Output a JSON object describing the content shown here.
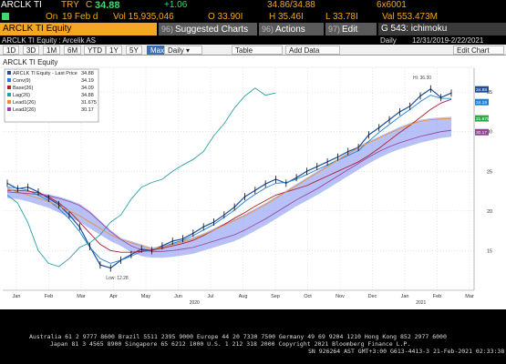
{
  "quote": {
    "ticker": "ARCLK TI",
    "currency": "TRY",
    "price_prefix": "C",
    "last_price": "34.88",
    "change": "+1.06",
    "bid_ask": "34.86/34.88",
    "size": "6x6001",
    "open_flag": "On",
    "date": "19 Feb d",
    "volume": "Vol 15,935,046",
    "open": "O 33.90I",
    "high": "H 35.46I",
    "low": "L 33.78I",
    "value": "Val 553.473M"
  },
  "toolbar": {
    "equity_label": "ARCLK TI Equity",
    "suggested_num": "96)",
    "suggested_label": "Suggested Charts",
    "actions_num": "96)",
    "actions_label": "Actions",
    "edit_num": "97)",
    "edit_label": "Edit",
    "page_label": "G 543: ichimoku"
  },
  "info_row": {
    "security": "ARCLK TI Equity : Arcelik AS",
    "frequency": "Daily",
    "date_range": "12/31/2019-2/22/2021"
  },
  "range_tabs": [
    "1D",
    "3D",
    "1M",
    "6M",
    "YTD",
    "1Y",
    "5Y"
  ],
  "range_selected": "Max",
  "frequency_select": "Daily",
  "table_label": "Table",
  "add_data_label": "Add Data",
  "edit_chart_label": "Edit Chart",
  "chart_title": "ARCLK TI Equity",
  "colors": {
    "accent": "#f5a623",
    "price": "#1f4e9a",
    "conversion": "#1f7fd1",
    "base": "#b01c2e",
    "lag": "#2a9fa6",
    "lead1": "#e8902a",
    "lead2": "#9a3f9a",
    "cloud": "#7b8ef0"
  },
  "chart_data": {
    "type": "line",
    "x_ticks": [
      "Jan",
      "Feb",
      "Mar",
      "Apr",
      "May",
      "Jun",
      "Jul",
      "Aug",
      "Sep",
      "Oct",
      "Nov",
      "Dec",
      "Jan",
      "Feb",
      "Mar"
    ],
    "year_labels": [
      "2020",
      "2021"
    ],
    "ylim": [
      10,
      38
    ],
    "y_ticks": [
      "35",
      "30",
      "25",
      "20",
      "15"
    ],
    "high_annotation": "Hi: 36.30",
    "low_annotation": "Low: 12.28",
    "legend_title": "ARCLK TI Equity - Last Price",
    "legend": [
      {
        "name": "Conv(9)",
        "value": "34.19"
      },
      {
        "name": "Base(26)",
        "value": "34.09"
      },
      {
        "name": "Lag(26)",
        "value": "34.88"
      },
      {
        "name": "Lead1(26)",
        "value": "31.675"
      },
      {
        "name": "Lead2(26)",
        "value": "30.17"
      }
    ],
    "last_price_value": "34.88",
    "right_tags": [
      "34.88",
      "34.19",
      "30.17",
      "31.675"
    ],
    "series": [
      {
        "name": "Last Price",
        "values": [
          23.5,
          22.8,
          23.0,
          22.4,
          21.6,
          20.8,
          19.5,
          18.0,
          15.5,
          13.2,
          12.8,
          13.8,
          14.5,
          15.2,
          15.0,
          15.6,
          16.2,
          16.5,
          17.2,
          18.0,
          18.6,
          19.5,
          20.5,
          21.8,
          22.6,
          23.4,
          24.0,
          23.5,
          24.2,
          25.0,
          25.6,
          26.2,
          26.8,
          27.5,
          28.0,
          29.6,
          30.5,
          31.5,
          32.5,
          33.2,
          34.5,
          35.4,
          34.3,
          34.88
        ]
      },
      {
        "name": "Conv(9)",
        "values": [
          23.0,
          22.9,
          22.6,
          22.0,
          21.3,
          20.3,
          19.0,
          17.4,
          15.4,
          14.0,
          13.4,
          13.8,
          14.3,
          14.9,
          15.0,
          15.4,
          15.9,
          16.3,
          16.9,
          17.6,
          18.3,
          19.2,
          20.1,
          21.2,
          22.1,
          22.9,
          23.5,
          23.6,
          24.0,
          24.6,
          25.2,
          25.8,
          26.4,
          27.0,
          27.6,
          28.8,
          29.9,
          30.9,
          31.9,
          32.8,
          33.8,
          34.6,
          34.2,
          34.19
        ]
      },
      {
        "name": "Base(26)",
        "values": [
          22.6,
          22.6,
          22.5,
          22.3,
          21.8,
          21.0,
          20.0,
          18.6,
          17.2,
          15.8,
          15.0,
          14.8,
          14.8,
          14.9,
          15.1,
          15.3,
          15.6,
          15.9,
          16.3,
          16.9,
          17.6,
          18.3,
          19.1,
          19.8,
          20.6,
          21.3,
          22.0,
          22.4,
          22.8,
          23.2,
          23.8,
          24.4,
          25.0,
          25.6,
          26.2,
          27.0,
          27.9,
          28.9,
          29.9,
          30.8,
          31.8,
          32.8,
          33.6,
          34.09
        ]
      },
      {
        "name": "Lag(26)",
        "values": [
          22.0,
          21.0,
          18.5,
          15.0,
          13.4,
          13.0,
          14.0,
          15.4,
          16.0,
          17.0,
          18.6,
          19.5,
          21.5,
          23.0,
          23.6,
          24.0,
          25.0,
          25.8,
          26.5,
          27.5,
          29.5,
          31.0,
          33.0,
          34.5,
          35.5,
          34.6,
          34.88,
          null,
          null,
          null,
          null,
          null,
          null,
          null,
          null,
          null,
          null,
          null,
          null,
          null,
          null,
          null,
          null,
          null
        ]
      },
      {
        "name": "Lead1(26)",
        "values": [
          22.8,
          22.4,
          22.0,
          21.6,
          21.2,
          20.6,
          20.0,
          19.4,
          18.6,
          17.8,
          17.0,
          16.4,
          16.0,
          15.6,
          15.2,
          15.4,
          15.8,
          16.1,
          16.5,
          17.0,
          17.6,
          18.2,
          18.8,
          19.4,
          20.1,
          20.8,
          21.6,
          22.4,
          23.2,
          24.0,
          24.8,
          25.6,
          26.4,
          27.2,
          28.0,
          28.6,
          29.2,
          29.8,
          30.4,
          30.9,
          31.3,
          31.5,
          31.6,
          31.675
        ]
      },
      {
        "name": "Lead2(26)",
        "values": [
          22.4,
          22.3,
          22.2,
          22.1,
          21.9,
          21.6,
          21.2,
          20.7,
          19.8,
          18.6,
          17.4,
          16.4,
          15.6,
          15.1,
          14.9,
          14.9,
          15.0,
          15.2,
          15.4,
          15.8,
          16.2,
          16.6,
          17.0,
          17.6,
          18.3,
          19.0,
          19.8,
          20.6,
          21.4,
          22.1,
          22.8,
          23.6,
          24.4,
          25.2,
          26.0,
          26.8,
          27.5,
          28.1,
          28.6,
          29.0,
          29.4,
          29.7,
          30.0,
          30.17
        ]
      }
    ]
  },
  "footer": {
    "line1": "Australia 61 2 9777 8600  Brazil 5511 2395 9000  Europe 44 20 7330 7500  Germany 49 69 9204 1210  Hong Kong 852 2977 6000",
    "line2": "Japan 81 3 4565 8900        Singapore 65 6212 1000        U.S. 1 212 318 2000            Copyright 2021 Bloomberg Finance L.P.",
    "line3": "SN 926264 AST  GMT+3:00 G613-4413-3 21-Feb-2021 02:33:38"
  }
}
